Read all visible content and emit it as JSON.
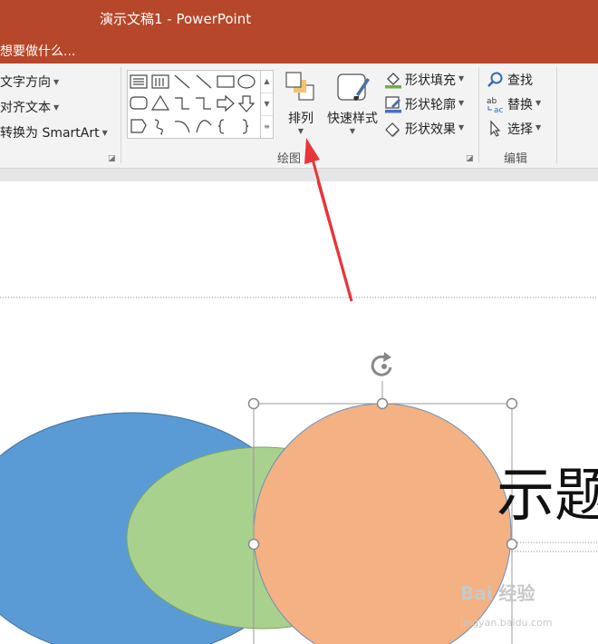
{
  "app": {
    "window_title": "演示文稿1 - PowerPoint"
  },
  "tell_me": {
    "text": "想要做什么..."
  },
  "paragraph": {
    "text_direction": "文字方向",
    "align_text": "对齐文本",
    "convert_smartart": "转换为 SmartArt"
  },
  "drawing": {
    "group_label": "绘图",
    "arrange_label": "排列",
    "quick_styles_label": "快速样式",
    "shape_fill": "形状填充",
    "shape_outline": "形状轮廓",
    "shape_effects": "形状效果"
  },
  "editing": {
    "group_label": "编辑",
    "find": "查找",
    "replace": "替换",
    "select": "选择"
  },
  "slide": {
    "title_fragment": "示题"
  },
  "watermark": {
    "brand": "Bai 经验",
    "url": "jingyan.baidu.com"
  },
  "colors": {
    "accent": "#b7472a",
    "ribbon_bg": "#f3f3f3",
    "blue_ellipse": "#5b9bd5",
    "green_ellipse": "#a9d18e",
    "orange_ellipse": "#f4b183",
    "annotation_arrow": "#e8353a"
  }
}
